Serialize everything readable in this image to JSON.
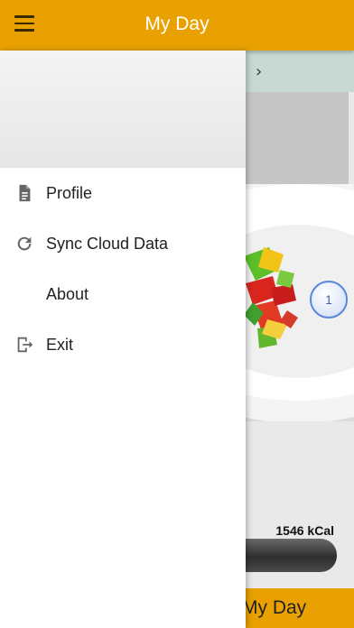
{
  "app_bar": {
    "title": "My Day"
  },
  "background": {
    "chevron": "›",
    "badge_count": "1",
    "calories": "1546 kCal",
    "bottom_button_label": "My Day"
  },
  "drawer": {
    "items": [
      {
        "label": "Profile",
        "icon": "document-icon"
      },
      {
        "label": "Sync Cloud Data",
        "icon": "refresh-icon"
      },
      {
        "label": "About",
        "icon": ""
      },
      {
        "label": "Exit",
        "icon": "exit-icon"
      }
    ]
  },
  "colors": {
    "app_bar": "#e8a100",
    "drawer_bg": "#ffffff",
    "icon_gray": "#666666"
  }
}
